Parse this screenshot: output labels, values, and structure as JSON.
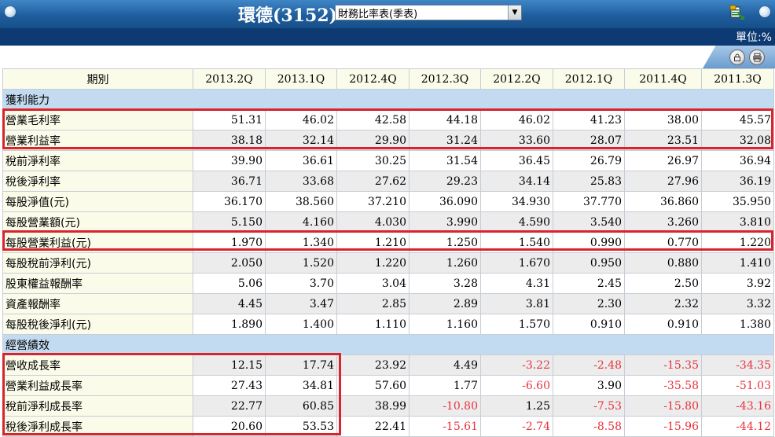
{
  "header": {
    "title": "環德(3152)",
    "report_select": "財務比率表(季表)",
    "unit": "單位:%"
  },
  "icons": {
    "excel": "excel-export-icon",
    "lock": "lock-icon",
    "print": "printer-icon",
    "dropdown": "chevron-down-icon"
  },
  "colors": {
    "title_bar": "#1f5e9e",
    "unit_bar": "#0d3a73",
    "label_bg": "#fbfbe9",
    "section_bg": "#c3dbf0",
    "alt_row_bg": "#ececec",
    "negative": "#e8333d",
    "highlight": "#d9232d"
  },
  "table": {
    "period_header": "期別",
    "periods": [
      "2013.2Q",
      "2013.1Q",
      "2012.4Q",
      "2012.3Q",
      "2012.2Q",
      "2012.1Q",
      "2011.4Q",
      "2011.3Q"
    ],
    "sections": [
      {
        "name": "獲利能力",
        "rows": [
          {
            "label": "營業毛利率",
            "values": [
              "51.31",
              "46.02",
              "42.58",
              "44.18",
              "46.02",
              "41.23",
              "38.00",
              "45.57"
            ]
          },
          {
            "label": "營業利益率",
            "values": [
              "38.18",
              "32.14",
              "29.90",
              "31.24",
              "33.60",
              "28.07",
              "23.51",
              "32.08"
            ]
          },
          {
            "label": "稅前淨利率",
            "values": [
              "39.90",
              "36.61",
              "30.25",
              "31.54",
              "36.45",
              "26.79",
              "26.97",
              "36.94"
            ]
          },
          {
            "label": "稅後淨利率",
            "values": [
              "36.71",
              "33.68",
              "27.62",
              "29.23",
              "34.14",
              "25.83",
              "27.96",
              "36.19"
            ]
          },
          {
            "label": "每股淨值(元)",
            "values": [
              "36.170",
              "38.560",
              "37.210",
              "36.090",
              "34.930",
              "37.770",
              "36.860",
              "35.950"
            ]
          },
          {
            "label": "每股營業額(元)",
            "values": [
              "5.150",
              "4.160",
              "4.030",
              "3.990",
              "4.590",
              "3.540",
              "3.260",
              "3.810"
            ]
          },
          {
            "label": "每股營業利益(元)",
            "values": [
              "1.970",
              "1.340",
              "1.210",
              "1.250",
              "1.540",
              "0.990",
              "0.770",
              "1.220"
            ]
          },
          {
            "label": "每股稅前淨利(元)",
            "values": [
              "2.050",
              "1.520",
              "1.220",
              "1.260",
              "1.670",
              "0.950",
              "0.880",
              "1.410"
            ]
          },
          {
            "label": "股東權益報酬率",
            "values": [
              "5.06",
              "3.70",
              "3.04",
              "3.28",
              "4.31",
              "2.45",
              "2.50",
              "3.92"
            ]
          },
          {
            "label": "資產報酬率",
            "values": [
              "4.45",
              "3.47",
              "2.85",
              "2.89",
              "3.81",
              "2.30",
              "2.32",
              "3.32"
            ]
          },
          {
            "label": "每股稅後淨利(元)",
            "values": [
              "1.890",
              "1.400",
              "1.110",
              "1.160",
              "1.570",
              "0.910",
              "0.910",
              "1.380"
            ]
          }
        ]
      },
      {
        "name": "經營績效",
        "rows": [
          {
            "label": "營收成長率",
            "values": [
              "12.15",
              "17.74",
              "23.92",
              "4.49",
              "-3.22",
              "-2.48",
              "-15.35",
              "-34.35"
            ]
          },
          {
            "label": "營業利益成長率",
            "values": [
              "27.43",
              "34.81",
              "57.60",
              "1.77",
              "-6.60",
              "3.90",
              "-35.58",
              "-51.03"
            ]
          },
          {
            "label": "稅前淨利成長率",
            "values": [
              "22.77",
              "60.85",
              "38.99",
              "-10.80",
              "1.25",
              "-7.53",
              "-15.80",
              "-43.16"
            ]
          },
          {
            "label": "稅後淨利成長率",
            "values": [
              "20.60",
              "53.53",
              "22.41",
              "-15.61",
              "-2.74",
              "-8.58",
              "-15.96",
              "-44.12"
            ]
          }
        ]
      }
    ]
  }
}
